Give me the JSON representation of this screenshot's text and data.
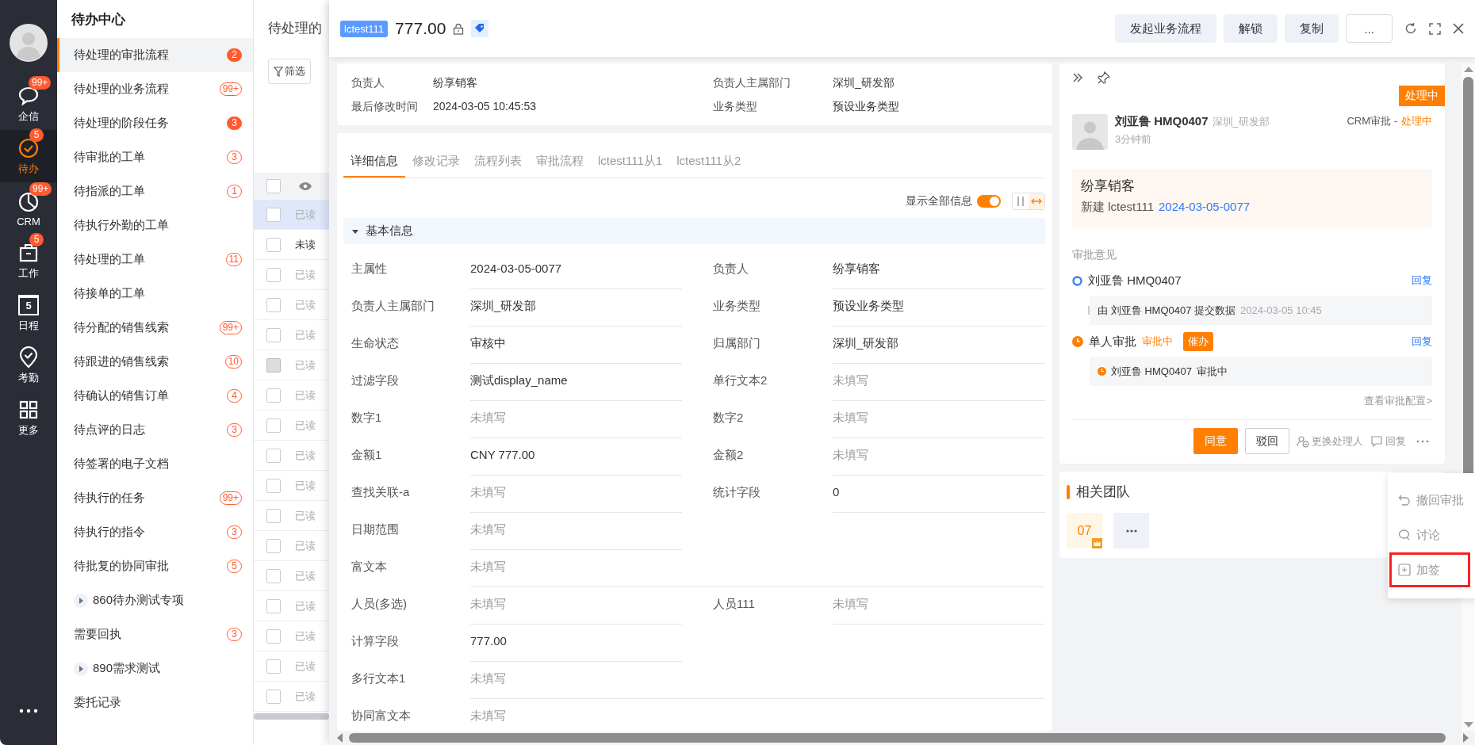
{
  "rail": [
    {
      "kind": "chat",
      "label": "企信",
      "badge": "99+",
      "selected": false
    },
    {
      "kind": "todo",
      "label": "待办",
      "badge": "5",
      "selected": true
    },
    {
      "kind": "crm",
      "label": "CRM",
      "badge": "99+",
      "selected": false
    },
    {
      "kind": "work",
      "label": "工作",
      "badge": "5",
      "selected": false
    },
    {
      "kind": "calendar",
      "label": "日程",
      "day": "5",
      "selected": false
    },
    {
      "kind": "attendance",
      "label": "考勤",
      "selected": false
    },
    {
      "kind": "more",
      "label": "更多",
      "selected": false
    }
  ],
  "sidebar": {
    "title": "待办中心",
    "items": [
      {
        "kind": "item",
        "label": "待处理的审批流程",
        "badge": "2",
        "badge_filled": true,
        "selected": true
      },
      {
        "kind": "item",
        "label": "待处理的业务流程",
        "badge": "99+",
        "badge_filled": false,
        "selected": false
      },
      {
        "kind": "item",
        "label": "待处理的阶段任务",
        "badge": "3",
        "badge_filled": true,
        "selected": false
      },
      {
        "kind": "item",
        "label": "待审批的工单",
        "badge": "3",
        "badge_filled": false,
        "selected": false
      },
      {
        "kind": "item",
        "label": "待指派的工单",
        "badge": "1",
        "badge_filled": false,
        "selected": false
      },
      {
        "kind": "item",
        "label": "待执行外勤的工单",
        "selected": false
      },
      {
        "kind": "item",
        "label": "待处理的工单",
        "badge": "11",
        "badge_filled": false,
        "selected": false
      },
      {
        "kind": "item",
        "label": "待接单的工单",
        "selected": false
      },
      {
        "kind": "item",
        "label": "待分配的销售线索",
        "badge": "99+",
        "badge_filled": false,
        "selected": false
      },
      {
        "kind": "item",
        "label": "待跟进的销售线索",
        "badge": "10",
        "badge_filled": false,
        "selected": false
      },
      {
        "kind": "item",
        "label": "待确认的销售订单",
        "badge": "4",
        "badge_filled": false,
        "selected": false
      },
      {
        "kind": "item",
        "label": "待点评的日志",
        "badge": "3",
        "badge_filled": false,
        "selected": false
      },
      {
        "kind": "item",
        "label": "待签署的电子文档",
        "selected": false
      },
      {
        "kind": "item",
        "label": "待执行的任务",
        "badge": "99+",
        "badge_filled": false,
        "selected": false
      },
      {
        "kind": "item",
        "label": "待执行的指令",
        "badge": "3",
        "badge_filled": false,
        "selected": false
      },
      {
        "kind": "item",
        "label": "待批复的协同审批",
        "badge": "5",
        "badge_filled": false,
        "selected": false
      },
      {
        "kind": "group",
        "label": "860待办测试专项",
        "expanded": false,
        "selected": false
      },
      {
        "kind": "item",
        "label": "需要回执",
        "badge": "3",
        "badge_filled": false,
        "selected": false
      },
      {
        "kind": "group",
        "label": "890需求测试",
        "expanded": false,
        "selected": false
      },
      {
        "kind": "item",
        "label": "委托记录",
        "selected": false
      }
    ]
  },
  "list": {
    "title": "待处理的",
    "filter": "筛选",
    "all_checked": false,
    "rows": [
      {
        "status": "已读",
        "read": true,
        "selected": true,
        "disabled": false
      },
      {
        "status": "未读",
        "read": false,
        "selected": false,
        "disabled": false
      },
      {
        "status": "已读",
        "read": true,
        "selected": false,
        "disabled": false
      },
      {
        "status": "已读",
        "read": true,
        "selected": false,
        "disabled": false
      },
      {
        "status": "已读",
        "read": true,
        "selected": false,
        "disabled": false
      },
      {
        "status": "已读",
        "read": true,
        "selected": false,
        "disabled": true
      },
      {
        "status": "已读",
        "read": true,
        "selected": false,
        "disabled": false
      },
      {
        "status": "已读",
        "read": true,
        "selected": false,
        "disabled": false
      },
      {
        "status": "已读",
        "read": true,
        "selected": false,
        "disabled": false
      },
      {
        "status": "已读",
        "read": true,
        "selected": false,
        "disabled": false
      },
      {
        "status": "已读",
        "read": true,
        "selected": false,
        "disabled": false
      },
      {
        "status": "已读",
        "read": true,
        "selected": false,
        "disabled": false
      },
      {
        "status": "已读",
        "read": true,
        "selected": false,
        "disabled": false
      },
      {
        "status": "已读",
        "read": true,
        "selected": false,
        "disabled": false
      },
      {
        "status": "已读",
        "read": true,
        "selected": false,
        "disabled": false
      },
      {
        "status": "已读",
        "read": true,
        "selected": false,
        "disabled": false
      },
      {
        "status": "已读",
        "read": true,
        "selected": false,
        "disabled": false
      }
    ]
  },
  "header": {
    "tag": "lctest111",
    "title": "777.00",
    "locked": true,
    "buttons": [
      {
        "kind": "filled",
        "label": "发起业务流程"
      },
      {
        "kind": "filled",
        "label": "解锁"
      },
      {
        "kind": "filled",
        "label": "复制"
      },
      {
        "kind": "outline",
        "label": "..."
      }
    ]
  },
  "summary": [
    {
      "label": "负责人",
      "value": "纷享销客"
    },
    {
      "label": "负责人主属部门",
      "value": "深圳_研发部"
    },
    {
      "label": "最后修改时间",
      "value": "2024-03-05 10:45:53"
    },
    {
      "label": "业务类型",
      "value": "预设业务类型"
    }
  ],
  "tabs": [
    {
      "label": "详细信息",
      "selected": true
    },
    {
      "label": "修改记录",
      "selected": false
    },
    {
      "label": "流程列表",
      "selected": false
    },
    {
      "label": "审批流程",
      "selected": false
    },
    {
      "label": "lctest111从1",
      "selected": false
    },
    {
      "label": "lctest111从2",
      "selected": false
    }
  ],
  "show_all": {
    "label": "显示全部信息",
    "on": true
  },
  "view_modes": [
    {
      "kind": "columns",
      "selected": false
    },
    {
      "kind": "stretch",
      "selected": true
    }
  ],
  "section": {
    "title": "基本信息",
    "expanded": true,
    "rows": [
      [
        {
          "kind": "normal",
          "label": "主属性",
          "value": "2024-03-05-0077",
          "empty": false
        },
        {
          "kind": "normal",
          "label": "负责人",
          "value": "纷享销客",
          "empty": false
        }
      ],
      [
        {
          "kind": "normal",
          "label": "负责人主属部门",
          "value": "深圳_研发部",
          "empty": false
        },
        {
          "kind": "normal",
          "label": "业务类型",
          "value": "预设业务类型",
          "empty": false
        }
      ],
      [
        {
          "kind": "normal",
          "label": "生命状态",
          "value": "审核中",
          "empty": false
        },
        {
          "kind": "normal",
          "label": "归属部门",
          "value": "深圳_研发部",
          "empty": false
        }
      ],
      [
        {
          "kind": "normal",
          "label": "过滤字段",
          "value": "测试display_name",
          "empty": false
        },
        {
          "kind": "normal",
          "label": "单行文本2",
          "value": "未填写",
          "empty": true
        }
      ],
      [
        {
          "kind": "normal",
          "label": "数字1",
          "value": "未填写",
          "empty": true
        },
        {
          "kind": "normal",
          "label": "数字2",
          "value": "未填写",
          "empty": true
        }
      ],
      [
        {
          "kind": "normal",
          "label": "金额1",
          "value": "CNY 777.00",
          "empty": false
        },
        {
          "kind": "normal",
          "label": "金额2",
          "value": "未填写",
          "empty": true
        }
      ],
      [
        {
          "kind": "normal",
          "label": "查找关联-a",
          "value": "未填写",
          "empty": true
        },
        {
          "kind": "normal",
          "label": "统计字段",
          "value": "0",
          "empty": false
        }
      ],
      [
        {
          "kind": "normal",
          "label": "日期范围",
          "value": "未填写",
          "empty": true
        }
      ],
      [
        {
          "kind": "wide",
          "label": "富文本",
          "value": "未填写",
          "empty": true
        }
      ],
      [
        {
          "kind": "normal",
          "label": "人员(多选)",
          "value": "未填写",
          "empty": true
        },
        {
          "kind": "normal",
          "label": "人员111",
          "value": "未填写",
          "empty": true
        }
      ],
      [
        {
          "kind": "normal",
          "label": "计算字段",
          "value": "777.00",
          "empty": false
        }
      ],
      [
        {
          "kind": "wide",
          "label": "多行文本1",
          "value": "未填写",
          "empty": true
        }
      ],
      [
        {
          "kind": "wide",
          "label": "协同富文本",
          "value": "未填写",
          "empty": true
        }
      ]
    ]
  },
  "approval": {
    "status_badge": "处理中",
    "submitter": {
      "name": "刘亚鲁 HMQ0407",
      "dept": "深圳_研发部",
      "time": "3分钟前"
    },
    "process": {
      "label": "CRM审批 -",
      "status": "处理中"
    },
    "card": {
      "title": "纷享销客",
      "prefix": "新建 lctest111",
      "link": "2024-03-05-0077"
    },
    "opinions_title": "审批意见",
    "timeline": [
      {
        "kind": "submitted",
        "title": "刘亚鲁 HMQ0407",
        "reply": "回复",
        "detail": "由 刘亚鲁 HMQ0407 提交数据",
        "time": "2024-03-05 10:45"
      },
      {
        "kind": "pending",
        "title": "单人审批",
        "status": "审批中",
        "urge": "催办",
        "reply": "回复",
        "detail": "刘亚鲁 HMQ0407",
        "detail_status": "审批中"
      }
    ],
    "config_link": "查看审批配置>",
    "actions": [
      {
        "kind": "primary",
        "label": "同意"
      },
      {
        "kind": "outline",
        "label": "驳回"
      },
      {
        "kind": "change",
        "label": "更换处理人"
      },
      {
        "kind": "reply",
        "label": "回复"
      },
      {
        "kind": "more"
      }
    ]
  },
  "team": {
    "title": "相关团队",
    "members": [
      {
        "label": "07",
        "owner": true
      }
    ],
    "more": true
  },
  "menu": [
    {
      "kind": "undo",
      "label": "撤回审批",
      "highlighted": false
    },
    {
      "kind": "discuss",
      "label": "讨论",
      "highlighted": false
    },
    {
      "kind": "add",
      "label": "加签",
      "highlighted": true
    }
  ]
}
